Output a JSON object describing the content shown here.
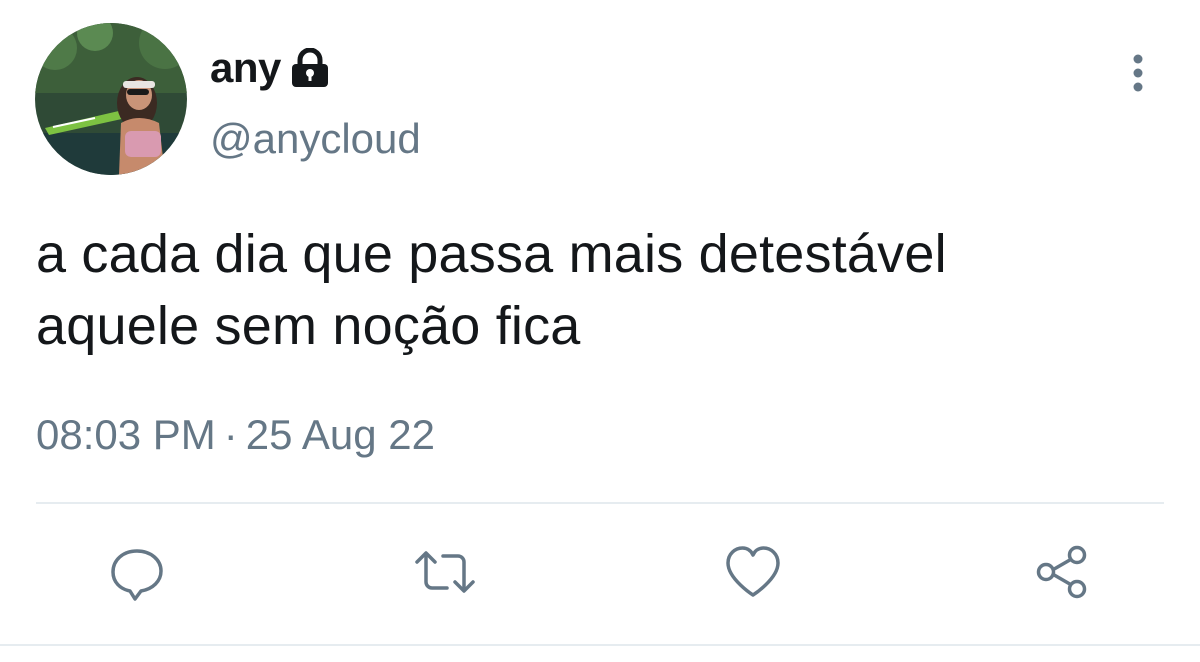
{
  "tweet": {
    "display_name": "any",
    "handle": "@anycloud",
    "text_line1": "a cada dia que passa mais detestável",
    "text_line2": "aquele sem noção fica",
    "time": "08:03 PM",
    "separator": "·",
    "date": "25 Aug 22",
    "protected_icon": "lock-icon",
    "menu_icon": "more-vertical-icon"
  },
  "actions": [
    {
      "name": "reply",
      "icon": "reply-icon"
    },
    {
      "name": "retweet",
      "icon": "retweet-icon"
    },
    {
      "name": "like",
      "icon": "heart-icon"
    },
    {
      "name": "share",
      "icon": "share-icon"
    }
  ],
  "colors": {
    "text_primary": "#14171a",
    "text_secondary": "#657786",
    "divider": "#e6ecf0",
    "icon": "#657786"
  }
}
